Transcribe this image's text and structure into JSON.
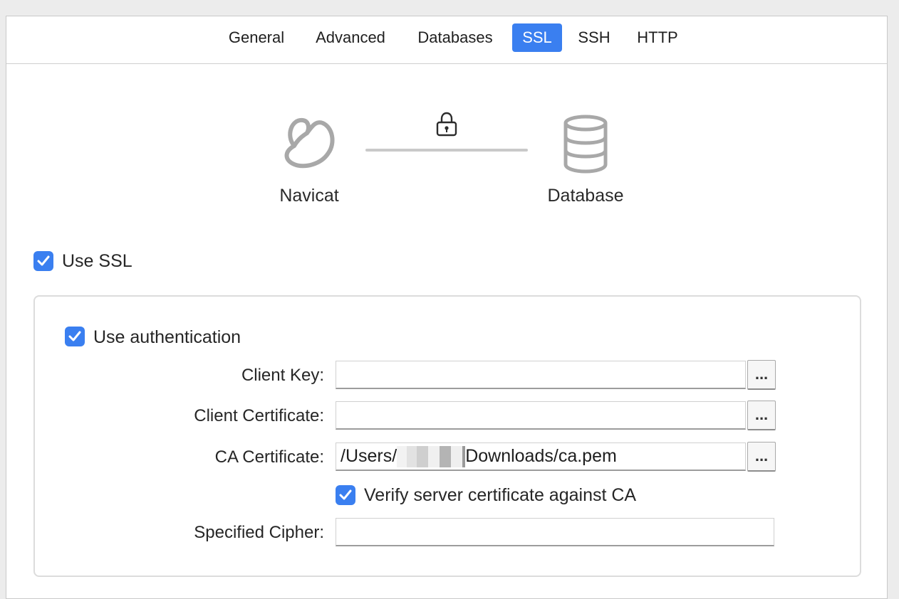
{
  "tabs": [
    {
      "label": "General",
      "active": false
    },
    {
      "label": "Advanced",
      "active": false
    },
    {
      "label": "Databases",
      "active": false
    },
    {
      "label": "SSL",
      "active": true
    },
    {
      "label": "SSH",
      "active": false
    },
    {
      "label": "HTTP",
      "active": false
    }
  ],
  "diagram": {
    "left_label": "Navicat",
    "right_label": "Database"
  },
  "use_ssl": {
    "label": "Use SSL",
    "checked": true
  },
  "auth": {
    "label": "Use authentication",
    "checked": true,
    "client_key": {
      "label": "Client Key:",
      "value": ""
    },
    "client_certificate": {
      "label": "Client Certificate:",
      "value": ""
    },
    "ca_certificate": {
      "label": "CA Certificate:",
      "value_prefix": "/Users/",
      "value_suffix": "Downloads/ca.pem"
    },
    "verify": {
      "label": "Verify server certificate against CA",
      "checked": true
    },
    "cipher": {
      "label": "Specified Cipher:",
      "value": ""
    },
    "browse_label": "..."
  },
  "colors": {
    "accent": "#3a7ff0",
    "icon_gray": "#a8a8a8"
  }
}
